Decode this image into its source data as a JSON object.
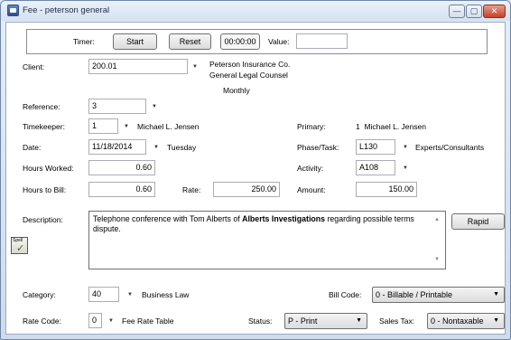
{
  "window": {
    "title": "Fee - peterson general",
    "min_glyph": "—",
    "max_glyph": "▢",
    "close_glyph": "✕"
  },
  "timer": {
    "label": "Timer:",
    "start_label": "Start",
    "reset_label": "Reset",
    "time_value": "00:00:00",
    "value_label": "Value:",
    "value": ""
  },
  "client": {
    "label": "Client:",
    "value": "200.01",
    "name_line1": "Peterson Insurance Co.",
    "name_line2": "General Legal Counsel",
    "billing_frequency": "Monthly"
  },
  "reference": {
    "label": "Reference:",
    "value": "3"
  },
  "timekeeper": {
    "label": "Timekeeper:",
    "value": "1",
    "name": "Michael L. Jensen"
  },
  "primary": {
    "label": "Primary:",
    "value": "1  Michael L. Jensen"
  },
  "date": {
    "label": "Date:",
    "value": "11/18/2014",
    "weekday": "Tuesday"
  },
  "phase_task": {
    "label": "Phase/Task:",
    "value": "L130",
    "description": "Experts/Consultants"
  },
  "hours_worked": {
    "label": "Hours Worked:",
    "value": "0.60"
  },
  "activity": {
    "label": "Activity:",
    "value": "A108"
  },
  "hours_to_bill": {
    "label": "Hours to Bill:",
    "value": "0.60"
  },
  "rate": {
    "label": "Rate:",
    "value": "250.00"
  },
  "amount": {
    "label": "Amount:",
    "value": "150.00"
  },
  "description": {
    "label": "Description:",
    "text_before": "Telephone conference with Tom Alberts of ",
    "text_bold": "Alberts Investigations",
    "text_after": " regarding possible terms dispute.",
    "rapid_label": "Rapid",
    "spell_label": "Spell"
  },
  "category": {
    "label": "Category:",
    "value": "40",
    "name": "Business Law"
  },
  "bill_code": {
    "label": "Bill Code:",
    "selected": "0 - Billable / Printable"
  },
  "rate_code": {
    "label": "Rate Code:",
    "value": "0",
    "name": "Fee Rate Table"
  },
  "status": {
    "label": "Status:",
    "selected": "P - Print"
  },
  "sales_tax": {
    "label": "Sales Tax:",
    "selected": "0 - Nontaxable"
  },
  "glyphs": {
    "dropdown_arrow": "▼",
    "scroll_up": "▲",
    "scroll_down": "▼",
    "spell_check": "✓"
  }
}
